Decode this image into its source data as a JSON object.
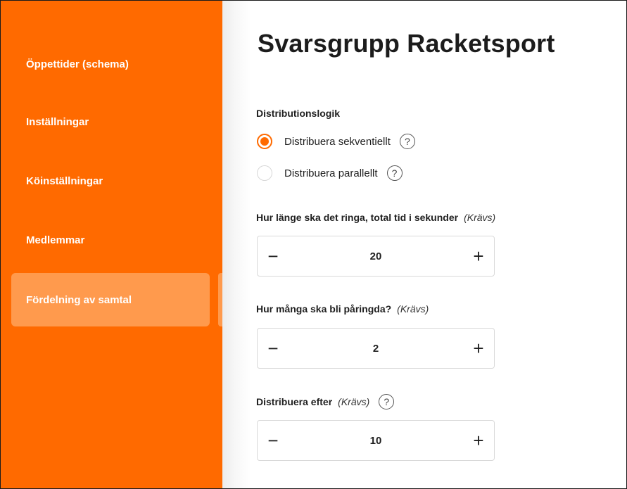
{
  "sidebar": {
    "items": [
      {
        "label": "Öppettider (schema)"
      },
      {
        "label": "Inställningar"
      },
      {
        "label": "Köinställningar"
      },
      {
        "label": "Medlemmar"
      },
      {
        "label": "Fördelning av samtal",
        "active": true
      }
    ],
    "accent_color": "#ff6a00",
    "active_color": "#ff9a4d"
  },
  "main": {
    "title": "Svarsgrupp Racketsport",
    "distribution": {
      "label": "Distributionslogik",
      "options": [
        {
          "label": "Distribuera sekventiellt",
          "checked": true,
          "icon": "help-icon"
        },
        {
          "label": "Distribuera parallellt",
          "checked": false,
          "icon": "help-icon"
        }
      ]
    },
    "ring_time": {
      "label": "Hur länge ska det ringa, total tid i sekunder",
      "required": "(Krävs)",
      "value": "20",
      "decrement": "−",
      "increment": "+"
    },
    "ring_count": {
      "label": "Hur många ska bli påringda?",
      "required": "(Krävs)",
      "value": "2",
      "decrement": "−",
      "increment": "+"
    },
    "distribute_after": {
      "label": "Distribuera efter",
      "required": "(Krävs)",
      "value": "10",
      "decrement": "−",
      "increment": "+",
      "icon": "help-icon"
    },
    "help_glyph": "?"
  }
}
